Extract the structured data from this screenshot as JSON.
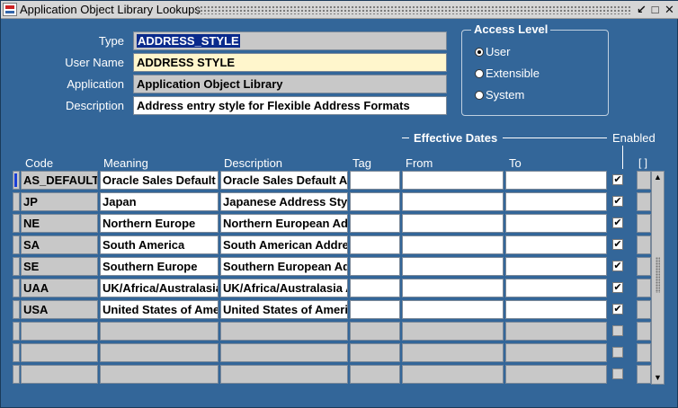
{
  "window": {
    "title": "Application Object Library Lookups"
  },
  "header": {
    "type_label": "Type",
    "type_value": "ADDRESS_STYLE",
    "user_name_label": "User Name",
    "user_name_value": "ADDRESS STYLE",
    "application_label": "Application",
    "application_value": "Application Object Library",
    "description_label": "Description",
    "description_value": "Address entry style for Flexible Address Formats"
  },
  "access_level": {
    "title": "Access Level",
    "options": [
      {
        "label": "User",
        "selected": true
      },
      {
        "label": "Extensible",
        "selected": false
      },
      {
        "label": "System",
        "selected": false
      }
    ]
  },
  "table": {
    "effective_dates_label": "Effective Dates",
    "enabled_label": "Enabled",
    "flex_label": "[ ]",
    "columns": {
      "code": "Code",
      "meaning": "Meaning",
      "description": "Description",
      "tag": "Tag",
      "from": "From",
      "to": "To"
    },
    "rows": [
      {
        "code": "AS_DEFAULT",
        "meaning": "Oracle Sales Default",
        "description": "Oracle Sales Default Address",
        "tag": "",
        "from": "",
        "to": "",
        "enabled": true
      },
      {
        "code": "JP",
        "meaning": "Japan",
        "description": "Japanese Address Style",
        "tag": "",
        "from": "",
        "to": "",
        "enabled": true
      },
      {
        "code": "NE",
        "meaning": "Northern Europe",
        "description": "Northern European Address",
        "tag": "",
        "from": "",
        "to": "",
        "enabled": true
      },
      {
        "code": "SA",
        "meaning": "South America",
        "description": "South American Address",
        "tag": "",
        "from": "",
        "to": "",
        "enabled": true
      },
      {
        "code": "SE",
        "meaning": "Southern Europe",
        "description": "Southern European Address",
        "tag": "",
        "from": "",
        "to": "",
        "enabled": true
      },
      {
        "code": "UAA",
        "meaning": "UK/Africa/Australasia",
        "description": "UK/Africa/Australasia Address",
        "tag": "",
        "from": "",
        "to": "",
        "enabled": true
      },
      {
        "code": "USA",
        "meaning": "United States of America",
        "description": "United States of America",
        "tag": "",
        "from": "",
        "to": "",
        "enabled": true
      },
      {
        "code": "",
        "meaning": "",
        "description": "",
        "tag": "",
        "from": "",
        "to": "",
        "enabled": false
      },
      {
        "code": "",
        "meaning": "",
        "description": "",
        "tag": "",
        "from": "",
        "to": "",
        "enabled": false
      },
      {
        "code": "",
        "meaning": "",
        "description": "",
        "tag": "",
        "from": "",
        "to": "",
        "enabled": false
      }
    ]
  }
}
